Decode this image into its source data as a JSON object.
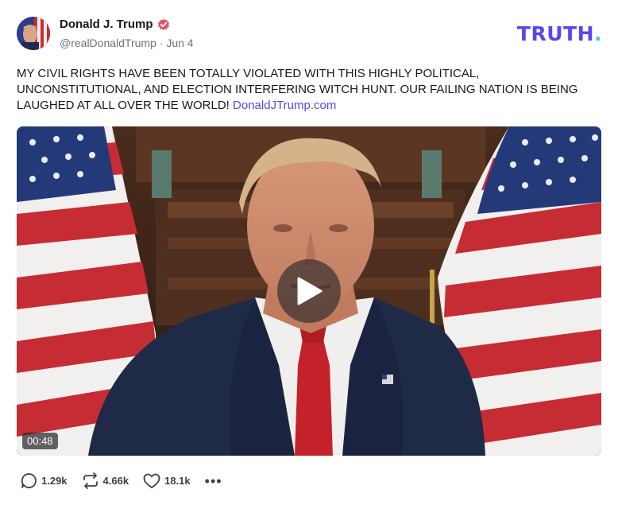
{
  "post": {
    "author_name": "Donald J. Trump",
    "handle": "@realDonaldTrump",
    "separator": "·",
    "date": "Jun 4",
    "text": "MY CIVIL RIGHTS HAVE BEEN TOTALLY VIOLATED WITH THIS HIGHLY POLITICAL, UNCONSTITUTIONAL, AND ELECTION INTERFERING WITCH HUNT. OUR FAILING NATION IS BEING LAUGHED AT ALL OVER THE WORLD!",
    "link": "DonaldJTrump.com"
  },
  "brand": {
    "logo_text": "TRUTH",
    "logo_dot": ".",
    "color": "#5448ee",
    "dot_color": "#3fd0b8"
  },
  "video": {
    "duration": "00:48"
  },
  "actions": {
    "replies": "1.29k",
    "retruths": "4.66k",
    "likes": "18.1k",
    "more": "•••"
  },
  "icons": {
    "verified": "verified-badge-icon",
    "play": "play-icon",
    "reply": "reply-icon",
    "retruth": "retruth-icon",
    "like": "heart-icon",
    "more": "more-icon"
  }
}
